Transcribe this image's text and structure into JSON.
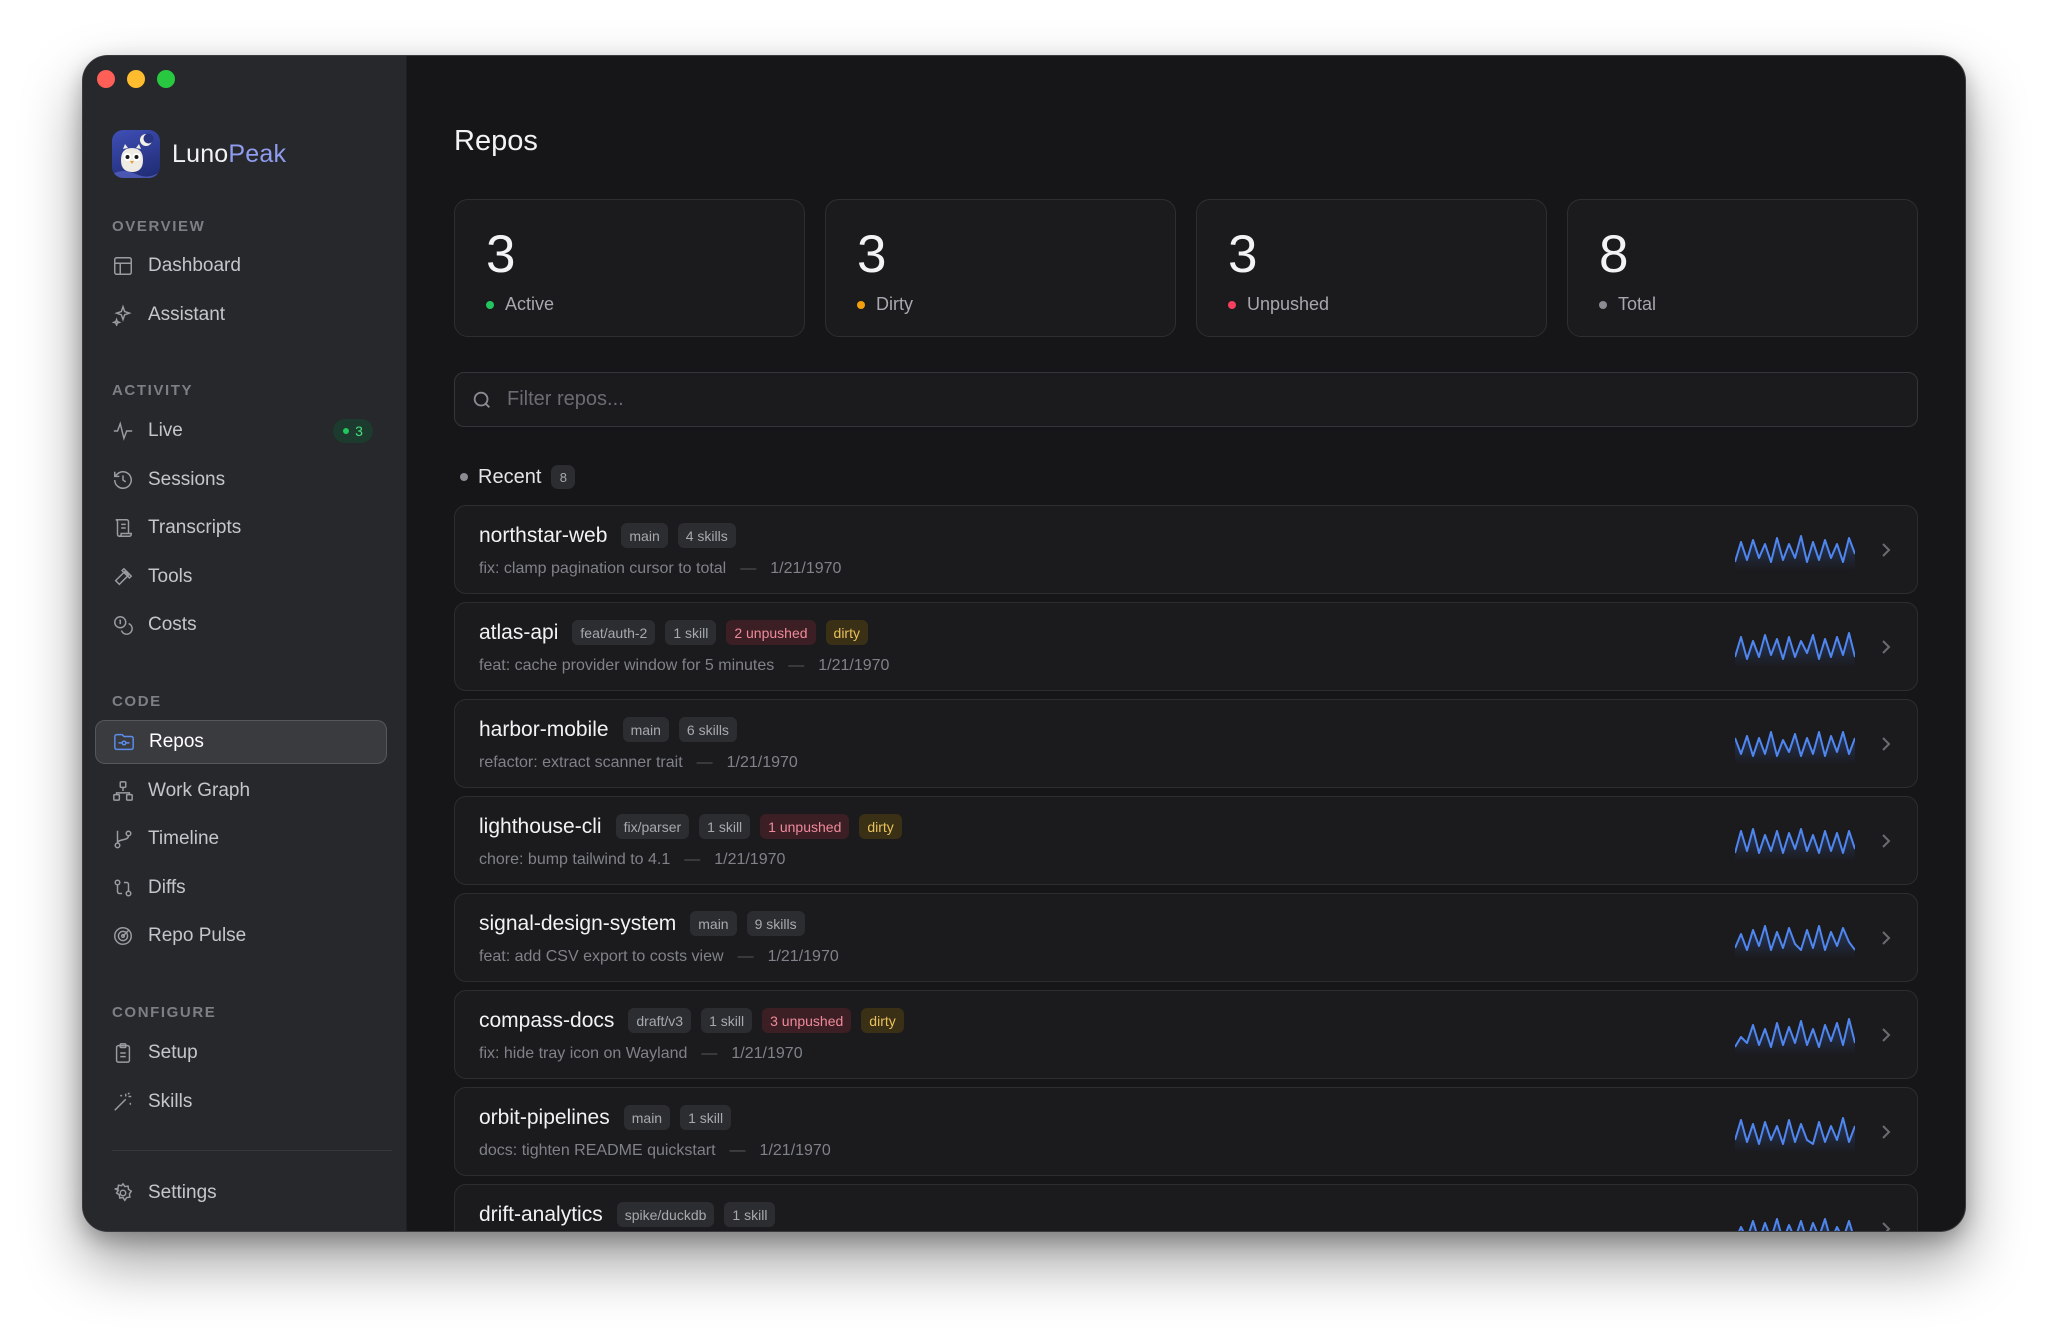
{
  "brand": {
    "name_part1": "Luno",
    "name_part2": "Peak",
    "accent_color": "#8f9cf0"
  },
  "sidebar": {
    "sections": [
      {
        "label": "OVERVIEW",
        "items": [
          {
            "label": "Dashboard",
            "icon": "layout-icon"
          },
          {
            "label": "Assistant",
            "icon": "sparkle-icon"
          }
        ]
      },
      {
        "label": "ACTIVITY",
        "items": [
          {
            "label": "Live",
            "icon": "pulse-icon",
            "badge": "3"
          },
          {
            "label": "Sessions",
            "icon": "history-icon"
          },
          {
            "label": "Transcripts",
            "icon": "scroll-icon"
          },
          {
            "label": "Tools",
            "icon": "hammer-icon"
          },
          {
            "label": "Costs",
            "icon": "coins-icon"
          }
        ]
      },
      {
        "label": "CODE",
        "items": [
          {
            "label": "Repos",
            "icon": "folder-git-icon",
            "active": true
          },
          {
            "label": "Work Graph",
            "icon": "graph-icon"
          },
          {
            "label": "Timeline",
            "icon": "branch-icon"
          },
          {
            "label": "Diffs",
            "icon": "diff-icon"
          },
          {
            "label": "Repo Pulse",
            "icon": "radar-icon"
          }
        ]
      },
      {
        "label": "CONFIGURE",
        "items": [
          {
            "label": "Setup",
            "icon": "clipboard-icon"
          },
          {
            "label": "Skills",
            "icon": "wand-icon"
          }
        ]
      }
    ],
    "settings": {
      "label": "Settings",
      "icon": "gear-icon"
    }
  },
  "main": {
    "title": "Repos",
    "stats": [
      {
        "value": "3",
        "label": "Active",
        "color": "#22c55e"
      },
      {
        "value": "3",
        "label": "Dirty",
        "color": "#f59e0b"
      },
      {
        "value": "3",
        "label": "Unpushed",
        "color": "#f43f5e"
      },
      {
        "value": "8",
        "label": "Total",
        "color": "#8a8c92"
      }
    ],
    "search": {
      "placeholder": "Filter repos..."
    },
    "group": {
      "label": "Recent",
      "count": "8"
    },
    "repos": [
      {
        "name": "northstar-web",
        "branch": "main",
        "skills": "4 skills",
        "unpushed": "",
        "dirty": "",
        "commit": "fix: clamp pagination cursor to total",
        "date": "1/21/1970"
      },
      {
        "name": "atlas-api",
        "branch": "feat/auth-2",
        "skills": "1 skill",
        "unpushed": "2 unpushed",
        "dirty": "dirty",
        "commit": "feat: cache provider window for 5 minutes",
        "date": "1/21/1970"
      },
      {
        "name": "harbor-mobile",
        "branch": "main",
        "skills": "6 skills",
        "unpushed": "",
        "dirty": "",
        "commit": "refactor: extract scanner trait",
        "date": "1/21/1970"
      },
      {
        "name": "lighthouse-cli",
        "branch": "fix/parser",
        "skills": "1 skill",
        "unpushed": "1 unpushed",
        "dirty": "dirty",
        "commit": "chore: bump tailwind to 4.1",
        "date": "1/21/1970"
      },
      {
        "name": "signal-design-system",
        "branch": "main",
        "skills": "9 skills",
        "unpushed": "",
        "dirty": "",
        "commit": "feat: add CSV export to costs view",
        "date": "1/21/1970"
      },
      {
        "name": "compass-docs",
        "branch": "draft/v3",
        "skills": "1 skill",
        "unpushed": "3 unpushed",
        "dirty": "dirty",
        "commit": "fix: hide tray icon on Wayland",
        "date": "1/21/1970"
      },
      {
        "name": "orbit-pipelines",
        "branch": "main",
        "skills": "1 skill",
        "unpushed": "",
        "dirty": "",
        "commit": "docs: tighten README quickstart",
        "date": "1/21/1970"
      },
      {
        "name": "drift-analytics",
        "branch": "spike/duckdb",
        "skills": "1 skill",
        "unpushed": "",
        "dirty": "",
        "commit": "",
        "date": ""
      }
    ]
  }
}
